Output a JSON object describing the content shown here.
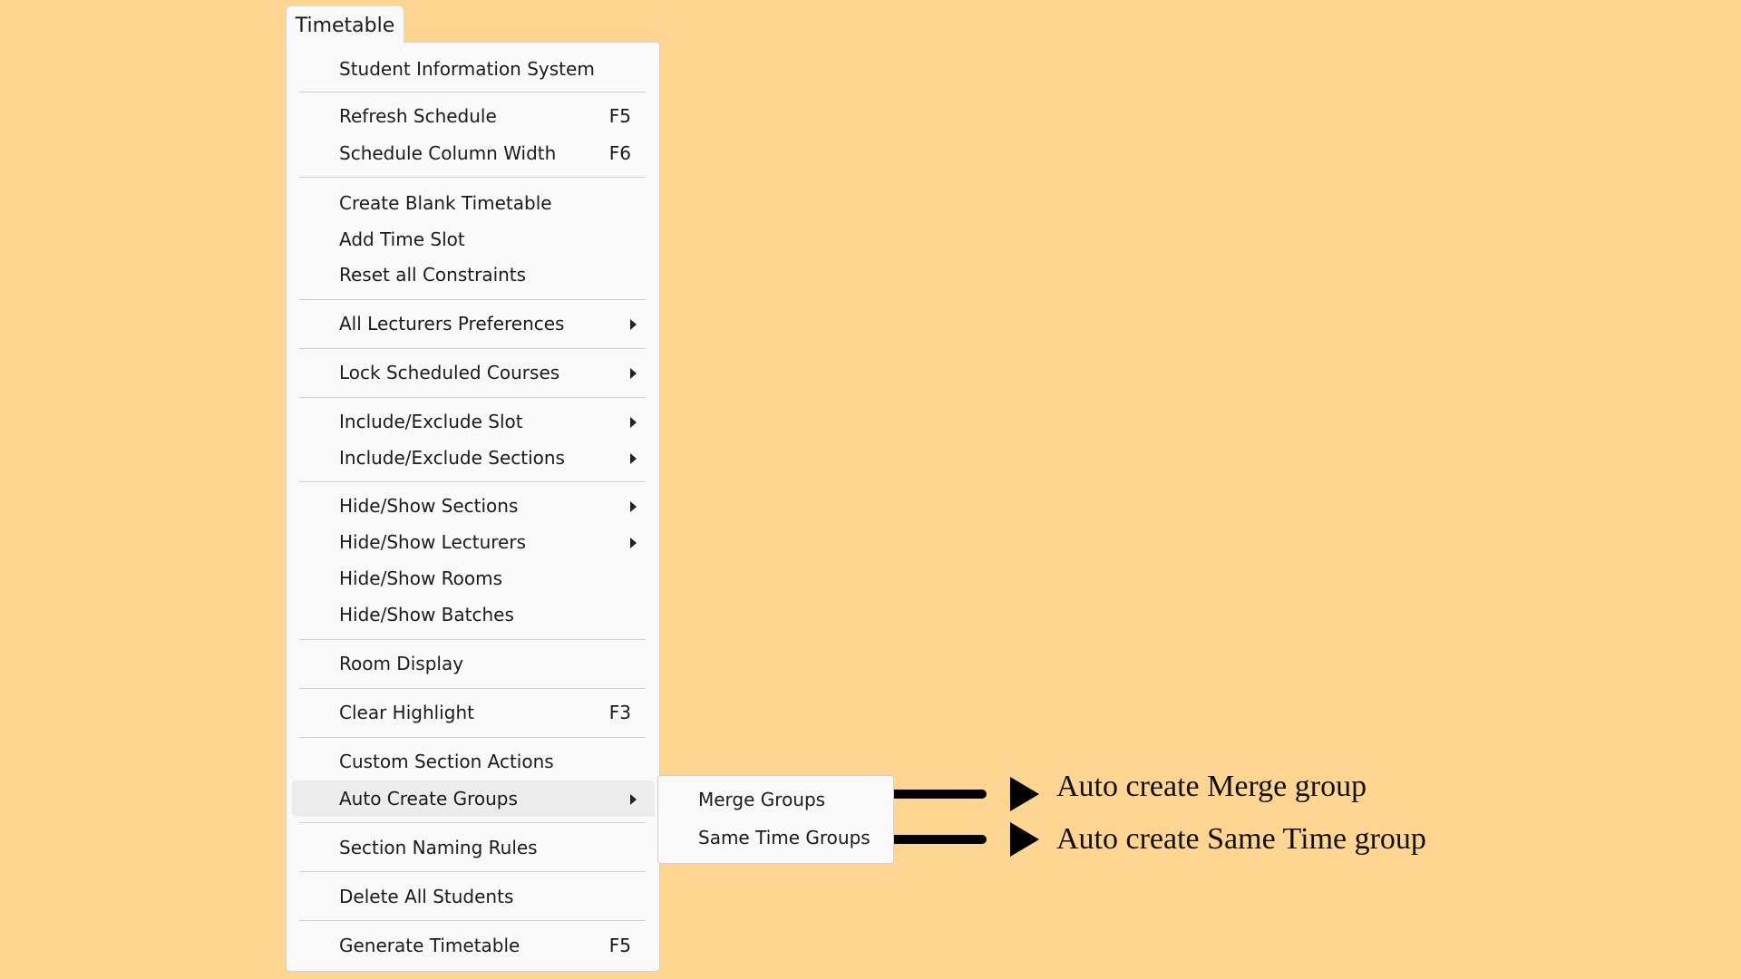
{
  "menu_tab": {
    "label": "Timetable"
  },
  "menu": {
    "items": [
      {
        "label": "Student Information System"
      },
      {
        "label": "Refresh Schedule",
        "shortcut": "F5"
      },
      {
        "label": "Schedule Column Width",
        "shortcut": "F6"
      },
      {
        "label": "Create Blank Timetable"
      },
      {
        "label": "Add Time Slot"
      },
      {
        "label": "Reset all Constraints"
      },
      {
        "label": "All Lecturers Preferences",
        "submenu": true
      },
      {
        "label": "Lock Scheduled Courses",
        "submenu": true
      },
      {
        "label": "Include/Exclude Slot",
        "submenu": true
      },
      {
        "label": "Include/Exclude Sections",
        "submenu": true
      },
      {
        "label": "Hide/Show Sections",
        "submenu": true
      },
      {
        "label": "Hide/Show Lecturers",
        "submenu": true
      },
      {
        "label": "Hide/Show Rooms"
      },
      {
        "label": "Hide/Show Batches"
      },
      {
        "label": "Room Display"
      },
      {
        "label": "Clear Highlight",
        "shortcut": "F3"
      },
      {
        "label": "Custom Section Actions"
      },
      {
        "label": "Auto Create Groups",
        "submenu": true,
        "highlighted": true
      },
      {
        "label": "Section Naming Rules"
      },
      {
        "label": "Delete All Students"
      },
      {
        "label": "Generate Timetable",
        "shortcut": "F5"
      }
    ]
  },
  "submenu": {
    "items": [
      {
        "label": "Merge Groups"
      },
      {
        "label": "Same Time Groups"
      }
    ]
  },
  "annotations": [
    {
      "text": "Auto create Merge group"
    },
    {
      "text": "Auto create Same Time group"
    }
  ],
  "colors": {
    "background": "#FFD592",
    "menu_background": "#F9F9F9",
    "highlight": "#ECECEC",
    "arrow": "#000000"
  }
}
